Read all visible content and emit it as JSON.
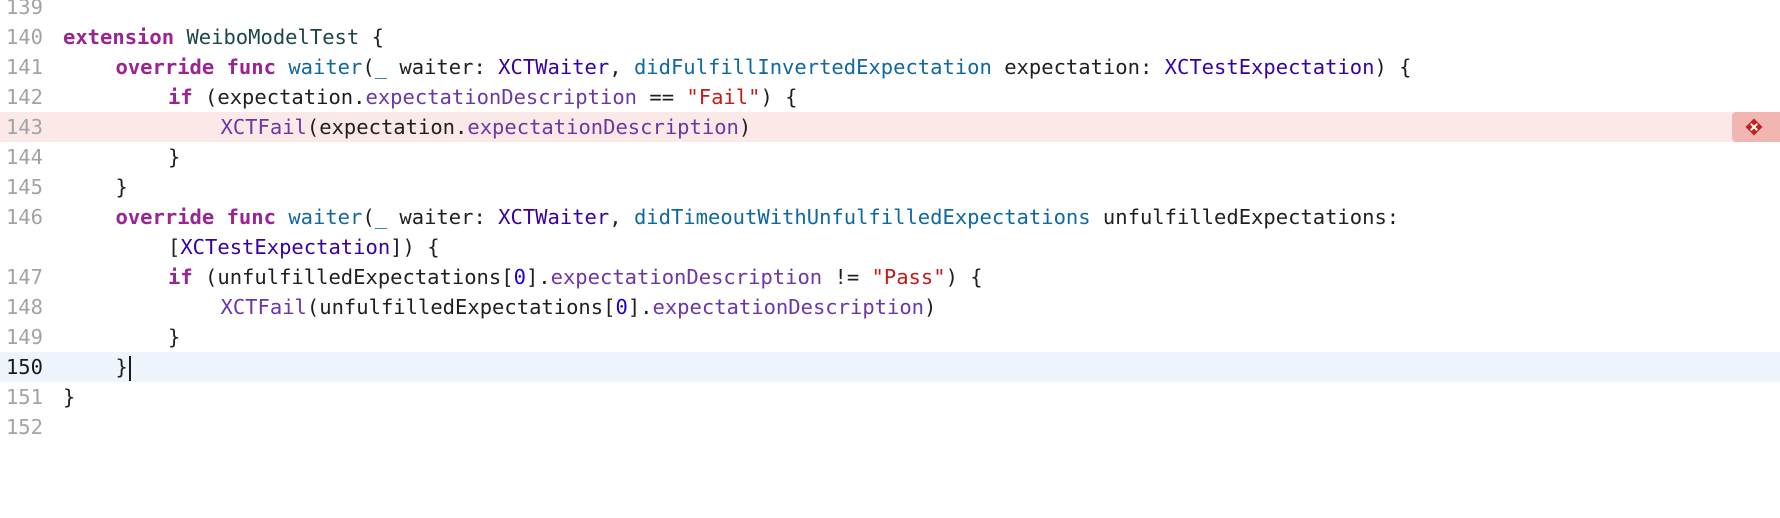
{
  "editor": {
    "lines": [
      {
        "number": "139",
        "indent": 0,
        "tokens": []
      },
      {
        "number": "140",
        "indent": 0,
        "tokens": [
          {
            "text": "extension",
            "kind": "kw"
          },
          {
            "text": " ",
            "kind": "plain"
          },
          {
            "text": "WeiboModelTest",
            "kind": "ext"
          },
          {
            "text": " {",
            "kind": "plain"
          }
        ]
      },
      {
        "number": "141",
        "indent": 1,
        "tokens": [
          {
            "text": "override",
            "kind": "kw"
          },
          {
            "text": " ",
            "kind": "plain"
          },
          {
            "text": "func",
            "kind": "kw"
          },
          {
            "text": " ",
            "kind": "plain"
          },
          {
            "text": "waiter",
            "kind": "decl"
          },
          {
            "text": "(",
            "kind": "plain"
          },
          {
            "text": "_",
            "kind": "decl"
          },
          {
            "text": " waiter: ",
            "kind": "plain"
          },
          {
            "text": "XCTWaiter",
            "kind": "type"
          },
          {
            "text": ", ",
            "kind": "plain"
          },
          {
            "text": "didFulfillInvertedExpectation",
            "kind": "decl"
          },
          {
            "text": " expectation: ",
            "kind": "plain"
          },
          {
            "text": "XCTestExpectation",
            "kind": "type"
          },
          {
            "text": ") {",
            "kind": "plain"
          }
        ]
      },
      {
        "number": "142",
        "indent": 2,
        "tokens": [
          {
            "text": "if",
            "kind": "kw"
          },
          {
            "text": " (expectation.",
            "kind": "plain"
          },
          {
            "text": "expectationDescription",
            "kind": "member"
          },
          {
            "text": " == ",
            "kind": "plain"
          },
          {
            "text": "\"Fail\"",
            "kind": "str"
          },
          {
            "text": ") {",
            "kind": "plain"
          }
        ]
      },
      {
        "number": "143",
        "indent": 3,
        "highlight": "error",
        "tokens": [
          {
            "text": "XCTFail",
            "kind": "member"
          },
          {
            "text": "(expectation.",
            "kind": "plain"
          },
          {
            "text": "expectationDescription",
            "kind": "member"
          },
          {
            "text": ")",
            "kind": "plain"
          }
        ]
      },
      {
        "number": "144",
        "indent": 2,
        "tokens": [
          {
            "text": "}",
            "kind": "plain"
          }
        ]
      },
      {
        "number": "145",
        "indent": 1,
        "tokens": [
          {
            "text": "}",
            "kind": "plain"
          }
        ]
      },
      {
        "number": "146",
        "indent": 1,
        "tokens": [
          {
            "text": "override",
            "kind": "kw"
          },
          {
            "text": " ",
            "kind": "plain"
          },
          {
            "text": "func",
            "kind": "kw"
          },
          {
            "text": " ",
            "kind": "plain"
          },
          {
            "text": "waiter",
            "kind": "decl"
          },
          {
            "text": "(",
            "kind": "plain"
          },
          {
            "text": "_",
            "kind": "decl"
          },
          {
            "text": " waiter: ",
            "kind": "plain"
          },
          {
            "text": "XCTWaiter",
            "kind": "type"
          },
          {
            "text": ", ",
            "kind": "plain"
          },
          {
            "text": "didTimeoutWithUnfulfilledExpectations",
            "kind": "decl"
          },
          {
            "text": " unfulfilledExpectations:",
            "kind": "plain"
          }
        ]
      },
      {
        "number": "",
        "indent": 2,
        "tokens": [
          {
            "text": "[",
            "kind": "plain"
          },
          {
            "text": "XCTestExpectation",
            "kind": "type"
          },
          {
            "text": "]) {",
            "kind": "plain"
          }
        ]
      },
      {
        "number": "147",
        "indent": 2,
        "tokens": [
          {
            "text": "if",
            "kind": "kw"
          },
          {
            "text": " (unfulfilledExpectations[",
            "kind": "plain"
          },
          {
            "text": "0",
            "kind": "num"
          },
          {
            "text": "].",
            "kind": "plain"
          },
          {
            "text": "expectationDescription",
            "kind": "member"
          },
          {
            "text": " != ",
            "kind": "plain"
          },
          {
            "text": "\"Pass\"",
            "kind": "str"
          },
          {
            "text": ") {",
            "kind": "plain"
          }
        ]
      },
      {
        "number": "148",
        "indent": 3,
        "tokens": [
          {
            "text": "XCTFail",
            "kind": "member"
          },
          {
            "text": "(unfulfilledExpectations[",
            "kind": "plain"
          },
          {
            "text": "0",
            "kind": "num"
          },
          {
            "text": "].",
            "kind": "plain"
          },
          {
            "text": "expectationDescription",
            "kind": "member"
          },
          {
            "text": ")",
            "kind": "plain"
          }
        ]
      },
      {
        "number": "149",
        "indent": 2,
        "tokens": [
          {
            "text": "}",
            "kind": "plain"
          }
        ]
      },
      {
        "number": "150",
        "indent": 1,
        "highlight": "current",
        "cursor": true,
        "tokens": [
          {
            "text": "}",
            "kind": "plain"
          }
        ]
      },
      {
        "number": "151",
        "indent": 0,
        "tokens": [
          {
            "text": "}",
            "kind": "plain"
          }
        ]
      },
      {
        "number": "152",
        "indent": 0,
        "tokens": []
      }
    ],
    "error_icon": "error-diamond-icon",
    "colors": {
      "keyword": "#9b2393",
      "type": "#3900a0",
      "declaration": "#0f68a0",
      "member": "#6c36a9",
      "string": "#c41a16",
      "number": "#1c00cf",
      "error_line_bg": "#fbe9e8",
      "error_badge": "#f2b6b2",
      "error_icon": "#c0211a",
      "current_line_bg": "#edf4fc"
    }
  }
}
